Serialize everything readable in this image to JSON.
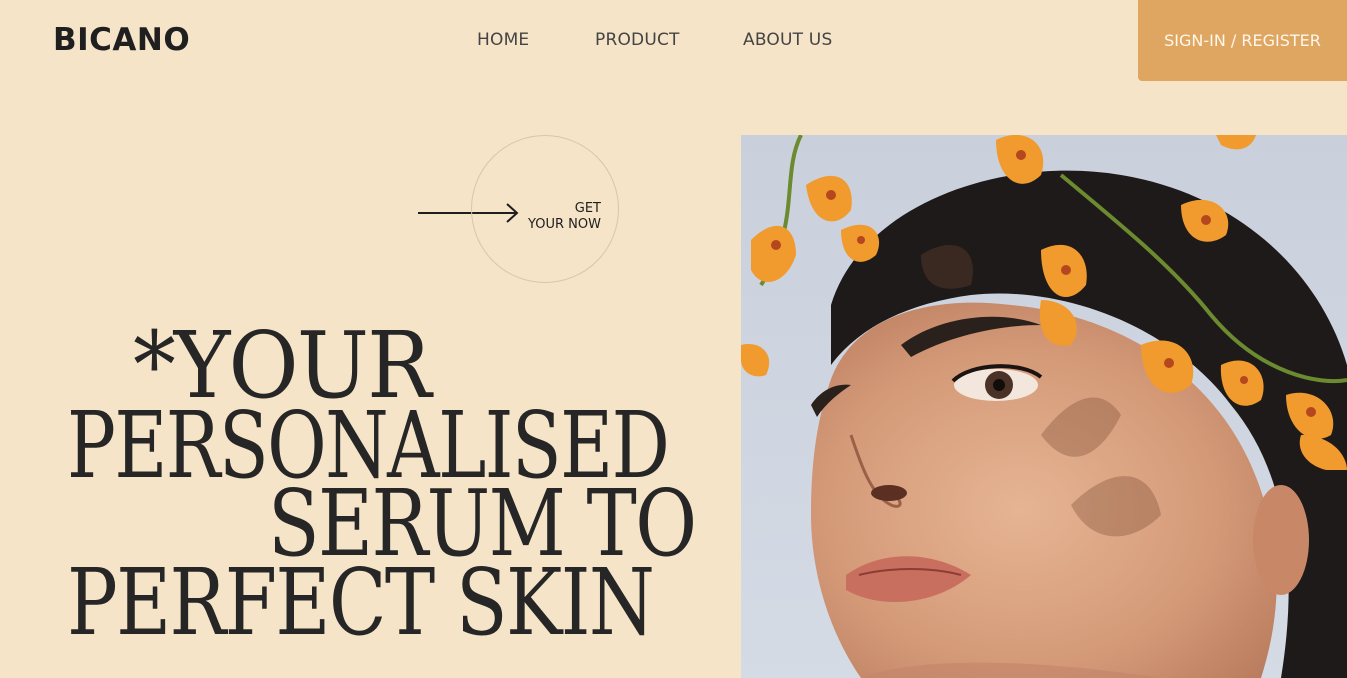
{
  "brand": {
    "logo_text": "BICANO"
  },
  "nav": {
    "items": [
      {
        "label": "HOME"
      },
      {
        "label": "PRODUCT"
      },
      {
        "label": "ABOUT US"
      }
    ]
  },
  "header": {
    "signin_label": "SIGN-IN / REGISTER"
  },
  "cta": {
    "line1": "GET",
    "line2": "YOUR NOW"
  },
  "hero": {
    "headline": {
      "line1": "*YOUR",
      "line2": "PERSONALISED",
      "line3": "SERUM TO",
      "line4": "PERFECT SKIN"
    },
    "image": {
      "icon": "model-portrait-with-orange-orchids"
    }
  },
  "colors": {
    "background": "#f6e4c8",
    "accent": "#dfa661",
    "text": "#262626"
  }
}
